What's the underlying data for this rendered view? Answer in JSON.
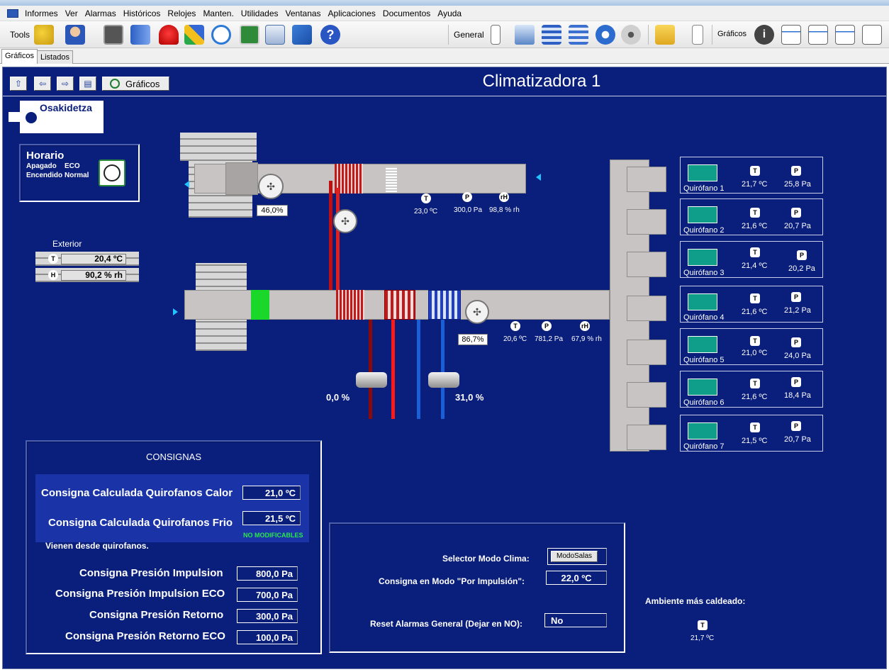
{
  "menu": [
    "Informes",
    "Ver",
    "Alarmas",
    "Históricos",
    "Relojes",
    "Manten.",
    "Utilidades",
    "Ventanas",
    "Aplicaciones",
    "Documentos",
    "Ayuda"
  ],
  "toolbar": {
    "tools_label": "Tools",
    "general_label": "General",
    "graficos_label": "Gráficos"
  },
  "tabs": [
    "Gráficos",
    "Listados"
  ],
  "page": {
    "title": "Climatizadora 1",
    "graficos_button": "Gráficos",
    "logo": "Osakidetza"
  },
  "horario": {
    "title": "Horario",
    "apagado_label": "Apagado",
    "apagado_value": "ECO",
    "encendido_label": "Encendido",
    "encendido_value": "Normal"
  },
  "exterior": {
    "label": "Exterior",
    "temp": "20,4 ºC",
    "hum": "90,2 % rh",
    "t_icon": "T",
    "h_icon": "H"
  },
  "upper_duct": {
    "damper": "46,0%",
    "temp": "23,0 ºC",
    "pressure": "300,0 Pa",
    "hum": "98,8 % rh"
  },
  "lower_duct": {
    "fan": "86,7%",
    "temp": "20,6 ºC",
    "pressure": "781,2 Pa",
    "hum": "67,9 % rh"
  },
  "valves": {
    "heat": "0,0 %",
    "cool": "31,0 %"
  },
  "rooms": [
    {
      "name": "Quirófano 1",
      "temp": "21,7 ºC",
      "pressure": "25,8 Pa"
    },
    {
      "name": "Quirófano 2",
      "temp": "21,6 ºC",
      "pressure": "20,7 Pa"
    },
    {
      "name": "Quirófano 3",
      "temp": "21,4 ºC",
      "pressure": "20,2 Pa"
    },
    {
      "name": "Quirófano 4",
      "temp": "21,6 ºC",
      "pressure": "21,2 Pa"
    },
    {
      "name": "Quirófano 5",
      "temp": "21,0 ºC",
      "pressure": "24,0 Pa"
    },
    {
      "name": "Quirófano 6",
      "temp": "21,6 ºC",
      "pressure": "18,4 Pa"
    },
    {
      "name": "Quirófano 7",
      "temp": "21,5 ºC",
      "pressure": "20,7 Pa"
    }
  ],
  "consignas": {
    "title": "CONSIGNAS",
    "calor_label": "Consigna Calculada Quirofanos Calor",
    "calor_value": "21,0 ºC",
    "frio_label": "Consigna Calculada Quirofanos Frio",
    "frio_value": "21,5 ºC",
    "no_mod": "NO MODIFICABLES",
    "note": "Vienen desde quirofanos.",
    "imp_label": "Consigna Presión Impulsion",
    "imp_value": "800,0 Pa",
    "imp_eco_label": "Consigna Presión Impulsion ECO",
    "imp_eco_value": "700,0 Pa",
    "ret_label": "Consigna Presión Retorno",
    "ret_value": "300,0 Pa",
    "ret_eco_label": "Consigna Presión Retorno ECO",
    "ret_eco_value": "100,0 Pa"
  },
  "modo": {
    "selector_label": "Selector Modo Clima:",
    "selector_value": "ModoSalas",
    "impulsion_label": "Consigna en Modo \"Por Impulsión\":",
    "impulsion_value": "22,0 ºC",
    "reset_label": "Reset Alarmas General (Dejar en NO):",
    "reset_value": "No"
  },
  "ambiente": {
    "label": "Ambiente más caldeado:",
    "value": "21,7 ºC"
  }
}
